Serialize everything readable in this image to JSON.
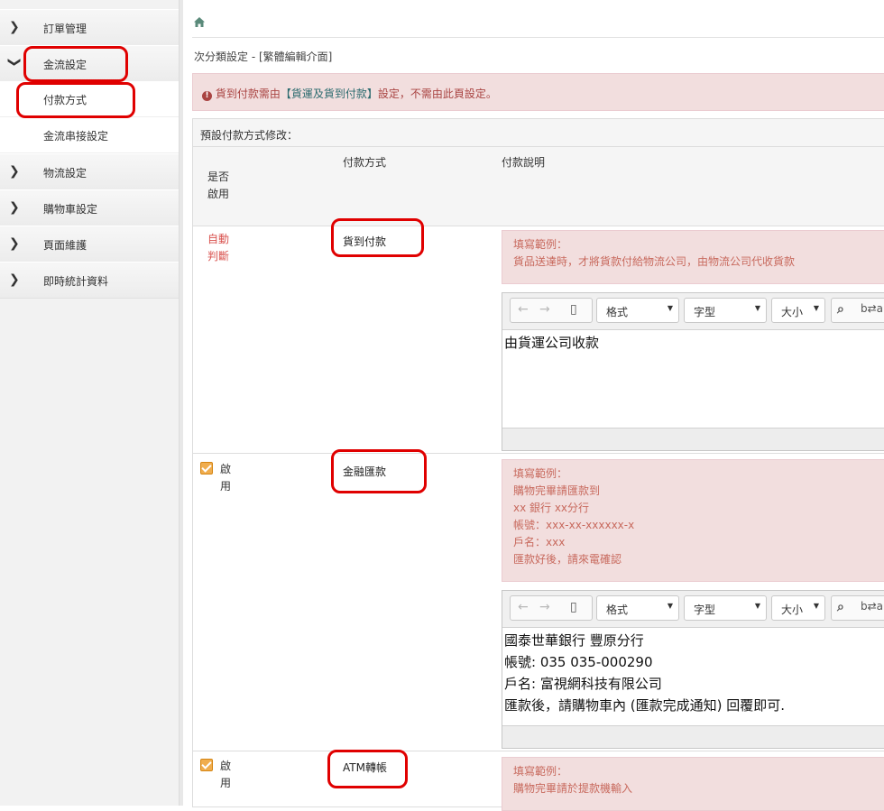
{
  "sidebar": {
    "items": [
      {
        "label": "訂單管理",
        "state": "collapsed"
      },
      {
        "label": "金流設定",
        "state": "expanded",
        "children": [
          "付款方式",
          "金流串接設定"
        ]
      },
      {
        "label": "物流設定",
        "state": "collapsed"
      },
      {
        "label": "購物車設定",
        "state": "collapsed"
      },
      {
        "label": "頁面維護",
        "state": "collapsed"
      },
      {
        "label": "即時統計資料",
        "state": "collapsed"
      }
    ]
  },
  "breadcrumb": {
    "icon": "home-icon"
  },
  "page": {
    "title_prefix": "次分類設定 - ",
    "title_bracket": "[繁體編輯介面]"
  },
  "alert": {
    "icon": "exclamation-circle-icon",
    "prefix": "貨到付款需由",
    "highlight": "【貨運及貨到付款】",
    "suffix": "設定，不需由此頁設定。"
  },
  "panel": {
    "heading": "預設付款方式修改：",
    "columns": {
      "enabled": "是否啟用",
      "method": "付款方式",
      "description": "付款說明"
    }
  },
  "editor_toolbar": {
    "format": "格式",
    "font": "字型",
    "size": "大小"
  },
  "rows": [
    {
      "enabled_text": "自動判斷",
      "method": "貨到付款",
      "example_title": "填寫範例：",
      "example_lines": [
        "貨品送達時，才將貨款付給物流公司，由物流公司代收貨款"
      ],
      "editor_lines": [
        "由貨運公司收款"
      ]
    },
    {
      "enabled_text": "啟用",
      "checked": true,
      "method": "金融匯款",
      "example_title": "填寫範例：",
      "example_lines": [
        "購物完畢請匯款到",
        "xx 銀行 xx分行",
        "帳號：xxx-xx-xxxxxx-x",
        "戶名：xxx",
        "匯款好後，請來電確認"
      ],
      "editor_lines": [
        "國泰世華銀行 豐原分行",
        "帳號: 035 035-000290",
        "戶名: 富視網科技有限公司",
        "匯款後，請購物車內 (匯款完成通知) 回覆即可."
      ]
    },
    {
      "enabled_text": "啟用",
      "checked": true,
      "method": "ATM轉帳",
      "example_title": "填寫範例：",
      "example_lines": [
        "購物完畢請於提款機輸入"
      ]
    }
  ],
  "colors": {
    "annotation": "#e00000",
    "alert_bg": "#f2dede",
    "alert_text": "#a94442",
    "checkbox": "#f0ad4e"
  }
}
